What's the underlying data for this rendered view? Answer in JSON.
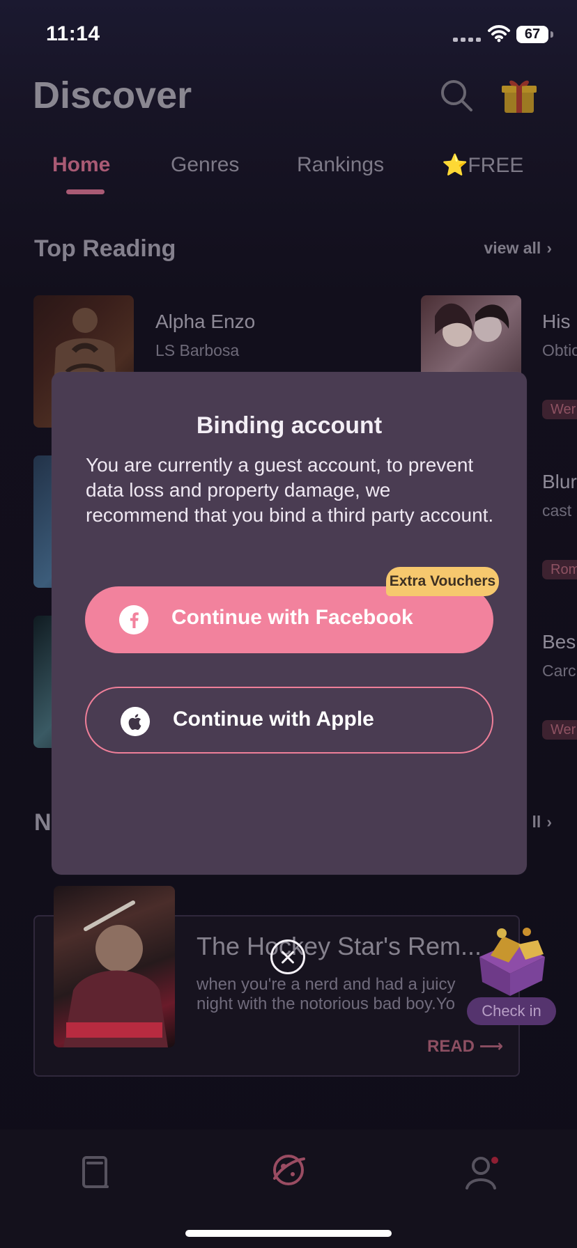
{
  "status_bar": {
    "time": "11:14",
    "battery": "67"
  },
  "header": {
    "title": "Discover",
    "search_icon": "search-icon",
    "gift_icon": "gift-icon"
  },
  "tabs": [
    {
      "label": "Home"
    },
    {
      "label": "Genres"
    },
    {
      "label": "Rankings"
    },
    {
      "label": "⭐FREE"
    }
  ],
  "top_reading": {
    "title": "Top Reading",
    "view_all": "view all",
    "books": [
      {
        "title": "Alpha Enzo",
        "author": "LS Barbosa",
        "genre": ""
      },
      {
        "title": "His",
        "author": "Obtic",
        "genre": "Wer"
      },
      {
        "title": "Blur",
        "author": "cast",
        "genre": "Rom"
      },
      {
        "title": "Bes",
        "author": "Carc",
        "genre": "Wer"
      }
    ]
  },
  "new_section": {
    "title_partial": "N",
    "view_all_partial": "ll"
  },
  "featured_card": {
    "title": "The Hockey Star's Rem...",
    "description": "when you're a nerd and had a juicy night with the notorious bad boy.Yo",
    "read": "READ ⟶"
  },
  "checkin": {
    "label": "Check in"
  },
  "modal": {
    "title": "Binding account",
    "message": "You are currently a guest account, to prevent data loss and property damage, we recommend that you bind a third party account.",
    "badge": "Extra Vouchers",
    "facebook_button": "Continue with Facebook",
    "apple_button": "Continue with Apple"
  },
  "colors": {
    "accent": "#f2829d",
    "modal_bg": "#4a3c52",
    "badge": "#f6c86e"
  }
}
